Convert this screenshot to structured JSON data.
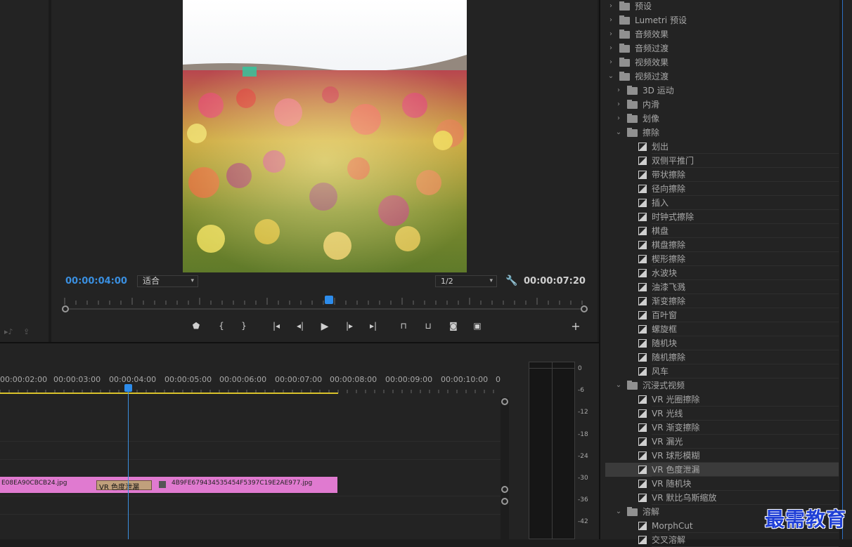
{
  "monitor": {
    "current_time": "00:00:04:00",
    "duration": "00:00:07:20",
    "fit_label": "适合",
    "resolution_label": "1/2"
  },
  "timeline": {
    "ruler_labels": [
      "00:00:02:00",
      "00:00:03:00",
      "00:00:04:00",
      "00:00:05:00",
      "00:00:06:00",
      "00:00:07:00",
      "00:00:08:00",
      "00:00:09:00",
      "00:00:10:00",
      "0"
    ],
    "clip1_name": "E08EA90CBCB24.jpg",
    "clip2_name": "4B9FE679434535454F5397C19E2AE977.jpg",
    "transition_name": "VR 色度泄漏"
  },
  "audio_meter": {
    "db_labels": [
      "0",
      "-6",
      "-12",
      "-18",
      "-24",
      "-30",
      "-36",
      "-42"
    ]
  },
  "effects": {
    "rows": [
      {
        "label": "预设",
        "level": 0,
        "type": "folder",
        "expanded": false
      },
      {
        "label": "Lumetri 预设",
        "level": 0,
        "type": "folder",
        "expanded": false
      },
      {
        "label": "音频效果",
        "level": 0,
        "type": "folder",
        "expanded": false
      },
      {
        "label": "音频过渡",
        "level": 0,
        "type": "folder",
        "expanded": false
      },
      {
        "label": "视频效果",
        "level": 0,
        "type": "folder",
        "expanded": false
      },
      {
        "label": "视频过渡",
        "level": 0,
        "type": "folder",
        "expanded": true
      },
      {
        "label": "3D 运动",
        "level": 1,
        "type": "folder",
        "expanded": false
      },
      {
        "label": "内滑",
        "level": 1,
        "type": "folder",
        "expanded": false
      },
      {
        "label": "划像",
        "level": 1,
        "type": "folder",
        "expanded": false
      },
      {
        "label": "擦除",
        "level": 1,
        "type": "folder",
        "expanded": true
      },
      {
        "label": "划出",
        "level": 2,
        "type": "effect"
      },
      {
        "label": "双侧平推门",
        "level": 2,
        "type": "effect"
      },
      {
        "label": "带状擦除",
        "level": 2,
        "type": "effect"
      },
      {
        "label": "径向擦除",
        "level": 2,
        "type": "effect"
      },
      {
        "label": "插入",
        "level": 2,
        "type": "effect"
      },
      {
        "label": "时钟式擦除",
        "level": 2,
        "type": "effect"
      },
      {
        "label": "棋盘",
        "level": 2,
        "type": "effect"
      },
      {
        "label": "棋盘擦除",
        "level": 2,
        "type": "effect"
      },
      {
        "label": "楔形擦除",
        "level": 2,
        "type": "effect"
      },
      {
        "label": "水波块",
        "level": 2,
        "type": "effect"
      },
      {
        "label": "油漆飞溅",
        "level": 2,
        "type": "effect"
      },
      {
        "label": "渐变擦除",
        "level": 2,
        "type": "effect"
      },
      {
        "label": "百叶窗",
        "level": 2,
        "type": "effect"
      },
      {
        "label": "螺旋框",
        "level": 2,
        "type": "effect"
      },
      {
        "label": "随机块",
        "level": 2,
        "type": "effect"
      },
      {
        "label": "随机擦除",
        "level": 2,
        "type": "effect"
      },
      {
        "label": "风车",
        "level": 2,
        "type": "effect"
      },
      {
        "label": "沉浸式视频",
        "level": 1,
        "type": "folder",
        "expanded": true
      },
      {
        "label": "VR 光圈擦除",
        "level": 2,
        "type": "effect"
      },
      {
        "label": "VR 光线",
        "level": 2,
        "type": "effect"
      },
      {
        "label": "VR 渐变擦除",
        "level": 2,
        "type": "effect"
      },
      {
        "label": "VR 漏光",
        "level": 2,
        "type": "effect"
      },
      {
        "label": "VR 球形模糊",
        "level": 2,
        "type": "effect"
      },
      {
        "label": "VR 色度泄漏",
        "level": 2,
        "type": "effect",
        "selected": true
      },
      {
        "label": "VR 随机块",
        "level": 2,
        "type": "effect"
      },
      {
        "label": "VR 默比乌斯缩放",
        "level": 2,
        "type": "effect"
      },
      {
        "label": "溶解",
        "level": 1,
        "type": "folder",
        "expanded": true
      },
      {
        "label": "MorphCut",
        "level": 2,
        "type": "effect"
      },
      {
        "label": "交叉溶解",
        "level": 2,
        "type": "effect"
      }
    ]
  },
  "watermark": "最需教育"
}
